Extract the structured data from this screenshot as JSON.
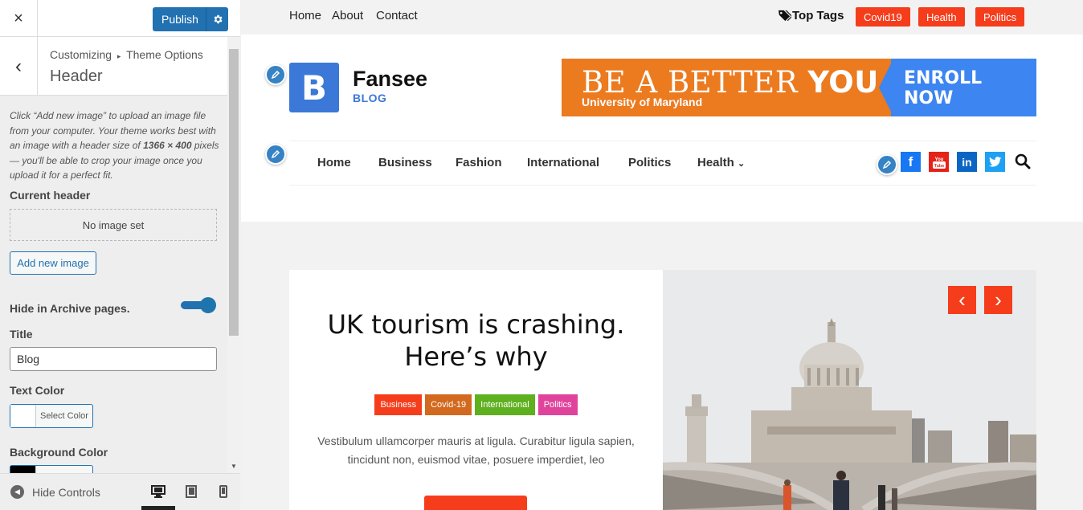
{
  "customizer": {
    "close_label": "×",
    "publish_label": "Publish",
    "breadcrumb_root": "Customizing",
    "breadcrumb_sep": "▸",
    "breadcrumb_section": "Theme Options",
    "section_title": "Header",
    "description_pre": "Click “Add new image” to upload an image file from your computer. Your theme works best with an image with a header size of ",
    "description_size": "1366 × 400",
    "description_post": " pixels — you'll be able to crop your image once you upload it for a perfect fit.",
    "current_header_label": "Current header",
    "no_image_text": "No image set",
    "add_image_label": "Add new image",
    "hide_archive_label": "Hide in Archive pages.",
    "hide_archive_on": true,
    "title_label": "Title",
    "title_value": "Blog",
    "text_color_label": "Text Color",
    "select_color_label": "Select Color",
    "bg_color_label": "Background Color",
    "hide_controls_label": "Hide Controls",
    "accent_color": "#2271b1"
  },
  "site": {
    "top_links": [
      "Home",
      "About",
      "Contact"
    ],
    "top_tags_label": "Top Tags",
    "top_tags": [
      "Covid19",
      "Health",
      "Politics"
    ],
    "site_name": "Fansee",
    "tagline": "BLOG",
    "logo_letter": "B",
    "banner": {
      "headline_light": "BE A BETTER ",
      "headline_bold": "YOU",
      "sub": "University of Maryland",
      "cta_line1": "ENROLL",
      "cta_line2": "NOW"
    },
    "nav": [
      "Home",
      "Business",
      "Fashion",
      "International",
      "Politics",
      "Health"
    ],
    "social_icons": [
      "facebook-icon",
      "youtube-icon",
      "linkedin-icon",
      "twitter-icon"
    ],
    "slide": {
      "title": "UK tourism is crashing. Here’s why",
      "categories": [
        {
          "label": "Business",
          "color": "#f53d1c"
        },
        {
          "label": "Covid-19",
          "color": "#d2691e"
        },
        {
          "label": "International",
          "color": "#5fb01f"
        },
        {
          "label": "Politics",
          "color": "#e0439b"
        }
      ],
      "excerpt": "Vestibulum ullamcorper mauris at ligula. Curabitur ligula sapien, tincidunt non, euismod vitae, posuere imperdiet, leo"
    },
    "brand_color": "#f53d1c"
  }
}
